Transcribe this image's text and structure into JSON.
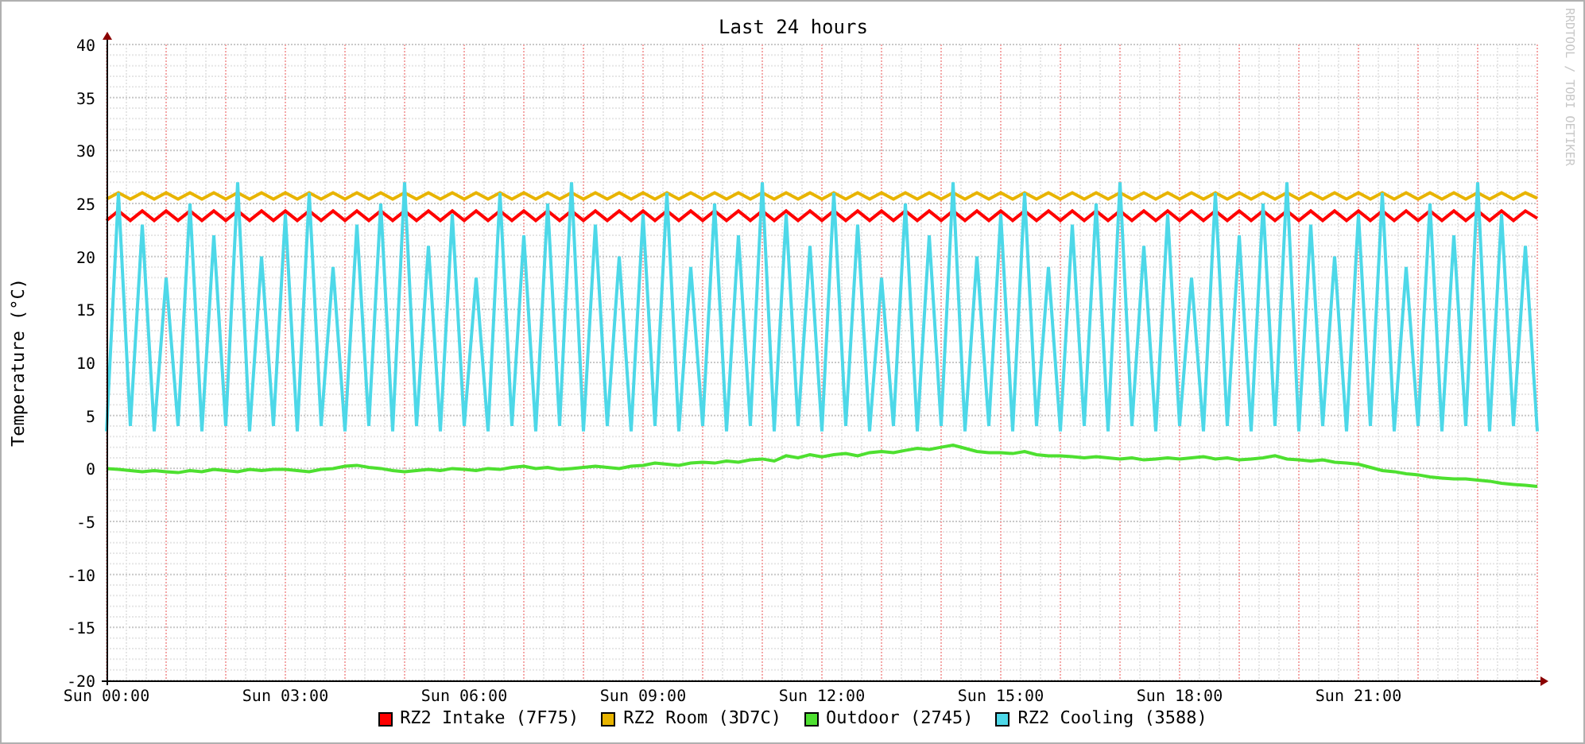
{
  "graph": {
    "credit": "RRDTOOL / TOBI OETIKER",
    "chart_data": {
      "type": "line",
      "grid": true,
      "title": "Last 24 hours",
      "ylabel": "Temperature (°C)",
      "ylim": [
        -20,
        40
      ],
      "yticks": [
        40,
        35,
        30,
        25,
        20,
        15,
        10,
        5,
        0,
        -5,
        -10,
        -15,
        -20
      ],
      "categories": [
        "Sun 00:00",
        null,
        null,
        null,
        null,
        null,
        null,
        null,
        null,
        null,
        null,
        null,
        null,
        null,
        null,
        "Sun 03:00",
        null,
        null,
        null,
        null,
        null,
        null,
        null,
        null,
        null,
        null,
        null,
        null,
        null,
        null,
        "Sun 06:00",
        null,
        null,
        null,
        null,
        null,
        null,
        null,
        null,
        null,
        null,
        null,
        null,
        null,
        null,
        "Sun 09:00",
        null,
        null,
        null,
        null,
        null,
        null,
        null,
        null,
        null,
        null,
        null,
        null,
        null,
        null,
        "Sun 12:00",
        null,
        null,
        null,
        null,
        null,
        null,
        null,
        null,
        null,
        null,
        null,
        null,
        null,
        null,
        "Sun 15:00",
        null,
        null,
        null,
        null,
        null,
        null,
        null,
        null,
        null,
        null,
        null,
        null,
        null,
        null,
        "Sun 18:00",
        null,
        null,
        null,
        null,
        null,
        null,
        null,
        null,
        null,
        null,
        null,
        null,
        null,
        null,
        "Sun 21:00",
        null,
        null,
        null,
        null,
        null,
        null,
        null,
        null,
        null,
        null,
        null,
        null,
        null,
        null,
        null
      ],
      "series": [
        {
          "name": "RZ2 Intake (7F75)",
          "color": "#ff0000",
          "values": [
            23.4,
            24.3,
            23.4,
            24.3,
            23.4,
            24.3,
            23.4,
            24.3,
            23.4,
            24.3,
            23.4,
            24.3,
            23.4,
            24.3,
            23.4,
            24.3,
            23.4,
            24.3,
            23.4,
            24.3,
            23.4,
            24.3,
            23.4,
            24.3,
            23.4,
            24.3,
            23.4,
            24.3,
            23.4,
            24.3,
            23.4,
            24.3,
            23.4,
            24.3,
            23.4,
            24.3,
            23.4,
            24.3,
            23.4,
            24.3,
            23.4,
            24.3,
            23.4,
            24.3,
            23.4,
            24.3,
            23.4,
            24.3,
            23.4,
            24.3,
            23.4,
            24.3,
            23.4,
            24.3,
            23.4,
            24.3,
            23.4,
            24.3,
            23.4,
            24.3,
            23.4,
            24.3,
            23.4,
            24.3,
            23.4,
            24.3,
            23.4,
            24.3,
            23.4,
            24.3,
            23.4,
            24.3,
            23.4,
            24.3,
            23.4,
            24.3,
            23.4,
            24.3,
            23.4,
            24.3,
            23.4,
            24.3,
            23.4,
            24.3,
            23.4,
            24.3,
            23.4,
            24.3,
            23.4,
            24.3,
            23.4,
            24.3,
            23.4,
            24.3,
            23.4,
            24.3,
            23.4,
            24.3,
            23.4,
            24.3,
            23.4,
            24.3,
            23.4,
            24.3,
            23.4,
            24.3,
            23.4,
            24.3,
            23.4,
            24.3,
            23.4,
            24.3,
            23.4,
            24.3,
            23.4,
            24.3,
            23.4,
            24.3,
            23.4,
            24.3,
            23.6
          ]
        },
        {
          "name": "RZ2 Room (3D7C)",
          "color": "#e8b400",
          "values": [
            25.4,
            26,
            25.4,
            26,
            25.4,
            26,
            25.4,
            26,
            25.4,
            26,
            25.4,
            26,
            25.4,
            26,
            25.4,
            26,
            25.4,
            26,
            25.4,
            26,
            25.4,
            26,
            25.4,
            26,
            25.4,
            26,
            25.4,
            26,
            25.4,
            26,
            25.4,
            26,
            25.4,
            26,
            25.4,
            26,
            25.4,
            26,
            25.4,
            26,
            25.4,
            26,
            25.4,
            26,
            25.4,
            26,
            25.4,
            26,
            25.4,
            26,
            25.4,
            26,
            25.4,
            26,
            25.4,
            26,
            25.4,
            26,
            25.4,
            26,
            25.4,
            26,
            25.4,
            26,
            25.4,
            26,
            25.4,
            26,
            25.4,
            26,
            25.4,
            26,
            25.4,
            26,
            25.4,
            26,
            25.4,
            26,
            25.4,
            26,
            25.4,
            26,
            25.4,
            26,
            25.4,
            26,
            25.4,
            26,
            25.4,
            26,
            25.4,
            26,
            25.4,
            26,
            25.4,
            26,
            25.4,
            26,
            25.4,
            26,
            25.4,
            26,
            25.4,
            26,
            25.4,
            26,
            25.4,
            26,
            25.4,
            26,
            25.4,
            26,
            25.4,
            26,
            25.4,
            26,
            25.4,
            26,
            25.4,
            26,
            25.5
          ]
        },
        {
          "name": "Outdoor (2745)",
          "color": "#4ee030",
          "values": [
            0,
            -0.1,
            -0.2,
            -0.3,
            -0.2,
            -0.3,
            -0.4,
            -0.2,
            -0.3,
            -0.1,
            -0.2,
            -0.3,
            -0.1,
            -0.2,
            -0.1,
            -0.1,
            -0.2,
            -0.3,
            -0.1,
            0,
            0.2,
            0.3,
            0.1,
            0,
            -0.2,
            -0.3,
            -0.2,
            -0.1,
            -0.2,
            0,
            -0.1,
            -0.2,
            0,
            -0.1,
            0.1,
            0.2,
            0,
            0.1,
            -0.1,
            0,
            0.1,
            0.2,
            0.1,
            0,
            0.2,
            0.3,
            0.5,
            0.4,
            0.3,
            0.5,
            0.6,
            0.5,
            0.7,
            0.6,
            0.8,
            0.9,
            0.7,
            1.2,
            1,
            1.3,
            1.1,
            1.3,
            1.4,
            1.2,
            1.5,
            1.6,
            1.5,
            1.7,
            1.9,
            1.8,
            2,
            2.2,
            1.9,
            1.6,
            1.5,
            1.5,
            1.4,
            1.6,
            1.3,
            1.2,
            1.2,
            1.1,
            1,
            1.1,
            1,
            0.9,
            1,
            0.8,
            0.9,
            1,
            0.9,
            1,
            1.1,
            0.9,
            1,
            0.8,
            0.9,
            1,
            1.2,
            0.9,
            0.8,
            0.7,
            0.8,
            0.6,
            0.5,
            0.4,
            0.1,
            -0.2,
            -0.3,
            -0.5,
            -0.6,
            -0.8,
            -0.9,
            -1,
            -1,
            -1.1,
            -1.2,
            -1.4,
            -1.5,
            -1.6,
            -1.7
          ]
        },
        {
          "name": "RZ2 Cooling (3588)",
          "color": "#4dd8e8",
          "values": [
            3.5,
            26,
            4,
            23,
            3.5,
            18,
            4,
            25,
            3.5,
            22,
            4,
            27,
            3.5,
            20,
            4,
            24,
            3.5,
            26,
            4,
            19,
            3.5,
            23,
            4,
            25,
            3.5,
            27,
            4,
            21,
            3.5,
            24,
            4,
            18,
            3.5,
            26,
            4,
            22,
            3.5,
            25,
            4,
            27,
            3.5,
            23,
            4,
            20,
            3.5,
            24,
            4,
            26,
            3.5,
            19,
            4,
            25,
            3.5,
            22,
            4,
            27,
            3.5,
            24,
            4,
            21,
            3.5,
            26,
            4,
            23,
            3.5,
            18,
            4,
            25,
            3.5,
            22,
            4,
            27,
            3.5,
            20,
            4,
            24,
            3.5,
            26,
            4,
            19,
            3.5,
            23,
            4,
            25,
            3.5,
            27,
            4,
            21,
            3.5,
            24,
            4,
            18,
            3.5,
            26,
            4,
            22,
            3.5,
            25,
            4,
            27,
            3.5,
            23,
            4,
            20,
            3.5,
            24,
            4,
            26,
            3.5,
            19,
            4,
            25,
            3.5,
            22,
            4,
            27,
            3.5,
            24,
            4,
            21,
            3.5
          ]
        }
      ]
    }
  }
}
